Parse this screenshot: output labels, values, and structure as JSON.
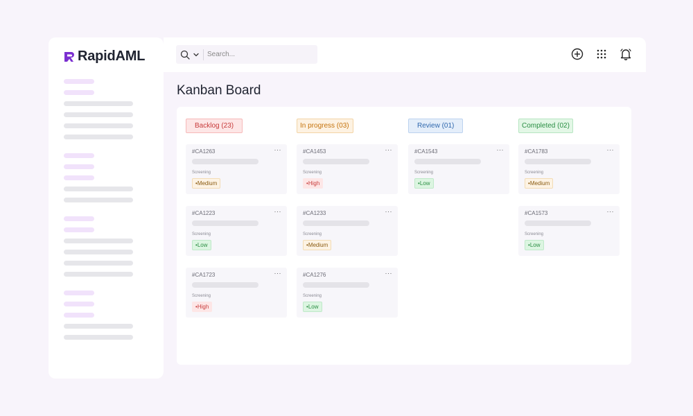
{
  "brand": {
    "name": "RapidAML",
    "accent": "#7b2fd0"
  },
  "search": {
    "placeholder": "Search..."
  },
  "header_icons": [
    "plus-circle-icon",
    "apps-grid-icon",
    "bell-icon"
  ],
  "page": {
    "title": "Kanban Board"
  },
  "columns": [
    {
      "label": "Backlog (23)",
      "color": "#c73b3b",
      "cards": [
        {
          "id": "#CA1263",
          "tag": "Screening",
          "priority": "Medium"
        },
        {
          "id": "#CA1223",
          "tag": "Screening",
          "priority": "Low"
        },
        {
          "id": "#CA1723",
          "tag": "Screening",
          "priority": "High"
        }
      ]
    },
    {
      "label": "In progress (03)",
      "color": "#c4730d",
      "cards": [
        {
          "id": "#CA1453",
          "tag": "Screening",
          "priority": "High"
        },
        {
          "id": "#CA1233",
          "tag": "Screening",
          "priority": "Medium"
        },
        {
          "id": "#CA1276",
          "tag": "Screening",
          "priority": "Low"
        }
      ]
    },
    {
      "label": "Review (01)",
      "color": "#2f68ad",
      "cards": [
        {
          "id": "#CA1543",
          "tag": "Screening",
          "priority": "Low"
        }
      ]
    },
    {
      "label": "Completed (02)",
      "color": "#2a8e43",
      "cards": [
        {
          "id": "#CA1783",
          "tag": "Screening",
          "priority": "Medium"
        },
        {
          "id": "#CA1573",
          "tag": "Screening",
          "priority": "Low"
        }
      ]
    }
  ],
  "card_more": "···",
  "bullet": "•"
}
